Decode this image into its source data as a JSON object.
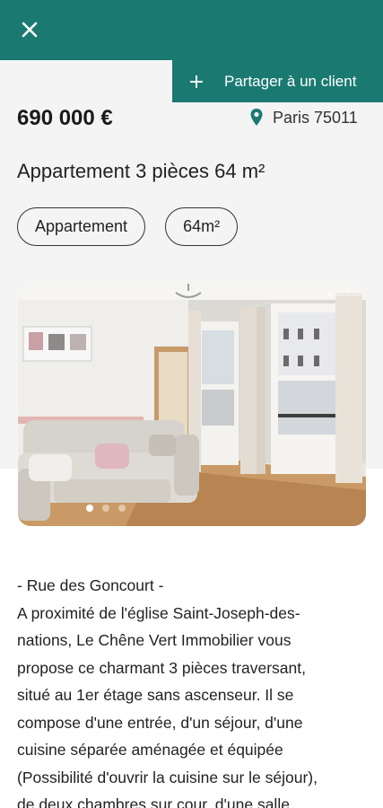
{
  "header": {
    "close_icon": "close-icon"
  },
  "actions": {
    "share_label": "Partager à un client",
    "share_icon": "plus-icon"
  },
  "listing": {
    "price": "690 000 €",
    "location": "Paris 75011",
    "location_icon": "map-pin-icon",
    "title": "Appartement 3 pièces 64 m²",
    "tags": [
      "Appartement",
      "64m²"
    ]
  },
  "gallery": {
    "watermark": "leboncoin",
    "photo_count": 3,
    "active_index": 0
  },
  "description": {
    "lines": [
      "- Rue des Goncourt -",
      "A proximité de l'église Saint-Joseph-des-",
      "nations, Le Chêne Vert Immobilier vous",
      "propose ce charmant 3 pièces traversant,",
      "situé au 1er étage sans ascenseur. Il se",
      "compose d'une entrée, d'un séjour, d'une",
      "cuisine séparée aménagée et équipée",
      "(Possibilité d'ouvrir la cuisine sur le séjour),",
      "de deux chambres sur cour, d'une salle"
    ]
  },
  "colors": {
    "brand": "#1a7a72",
    "background": "#f4f4f4"
  }
}
